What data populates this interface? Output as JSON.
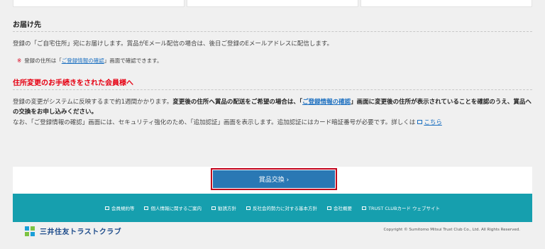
{
  "delivery": {
    "heading": "お届け先",
    "text": "登録の「ご自宅住所」宛にお届けします。賞品がEメール配信の場合は、後日ご登録のEメールアドレスに配信します。",
    "note_mark": "※",
    "note_pre": "登録の住所は「",
    "note_link": "ご登録情報の確認",
    "note_post": "」画面で確認できます。"
  },
  "address_change": {
    "heading": "住所変更のお手続きをされた会員様へ",
    "text_plain": "登録の変更がシステムに反映するまで約1週間かかります。",
    "text_bold_1": "変更後の住所へ賞品の配送をご希望の場合は、「",
    "text_bold_link": "ご登録情報の確認",
    "text_bold_2": "」画面に変更後の住所が表示されていることを確認のうえ、賞品への交換をお申し込みください。",
    "text3_pre": "なお、「ご登録情報の確認」画面には、セキュリティ強化のため、「追加認証」画面を表示します。追加認証にはカード暗証番号が必要です。詳しくは",
    "text3_link": "こちら"
  },
  "exchange_button": {
    "label": "賞品交換 ›"
  },
  "footer": {
    "links": [
      "会員規約等",
      "個人情報に関するご案内",
      "勧誘方針",
      "反社会的勢力に対する基本方針",
      "会社概要",
      "TRUST CLUBカード ウェブサイト"
    ],
    "brand": "三井住友トラストクラブ",
    "copyright": "Copyright © Sumitomo Mitsui Trust Club Co., Ltd. All Rights Reserved."
  }
}
